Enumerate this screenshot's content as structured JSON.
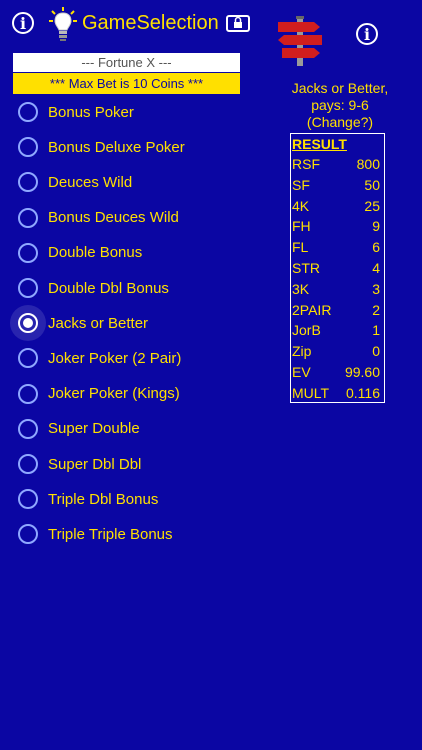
{
  "header": {
    "title": "GameSelection"
  },
  "machine": {
    "name": "--- Fortune X ---",
    "max_bet": "*** Max Bet is 10 Coins ***"
  },
  "games": [
    {
      "label": "Bonus Poker",
      "selected": false
    },
    {
      "label": "Bonus Deluxe Poker",
      "selected": false
    },
    {
      "label": "Deuces Wild",
      "selected": false
    },
    {
      "label": "Bonus Deuces Wild",
      "selected": false
    },
    {
      "label": "Double Bonus",
      "selected": false
    },
    {
      "label": "Double Dbl Bonus",
      "selected": false
    },
    {
      "label": "Jacks or Better",
      "selected": true
    },
    {
      "label": "Joker Poker (2 Pair)",
      "selected": false
    },
    {
      "label": "Joker Poker (Kings)",
      "selected": false
    },
    {
      "label": "Super Double",
      "selected": false
    },
    {
      "label": "Super Dbl Dbl",
      "selected": false
    },
    {
      "label": "Triple Dbl Bonus",
      "selected": false
    },
    {
      "label": "Triple Triple Bonus",
      "selected": false
    }
  ],
  "pays": {
    "line1": "Jacks or Better,",
    "line2": "pays: 9-6",
    "line3": "(Change?)"
  },
  "result": {
    "title": "RESULT",
    "rows": [
      {
        "key": "RSF",
        "value": "800"
      },
      {
        "key": "SF",
        "value": "50"
      },
      {
        "key": "4K",
        "value": "25"
      },
      {
        "key": "FH",
        "value": "9"
      },
      {
        "key": "FL",
        "value": "6"
      },
      {
        "key": "STR",
        "value": "4"
      },
      {
        "key": "3K",
        "value": "3"
      },
      {
        "key": "2PAIR",
        "value": "2"
      },
      {
        "key": "JorB",
        "value": "1"
      },
      {
        "key": "Zip",
        "value": "0"
      },
      {
        "key": "EV",
        "value": "99.60"
      },
      {
        "key": "MULT",
        "value": "0.116"
      }
    ]
  },
  "colors": {
    "background": "#0b06a3",
    "text": "#ffe000",
    "radio_ring": "#8fa8ff",
    "radio_checked": "#ffffff"
  },
  "icons": [
    "info-icon",
    "lightbulb-icon",
    "lock-screen-icon",
    "signpost-icon"
  ]
}
